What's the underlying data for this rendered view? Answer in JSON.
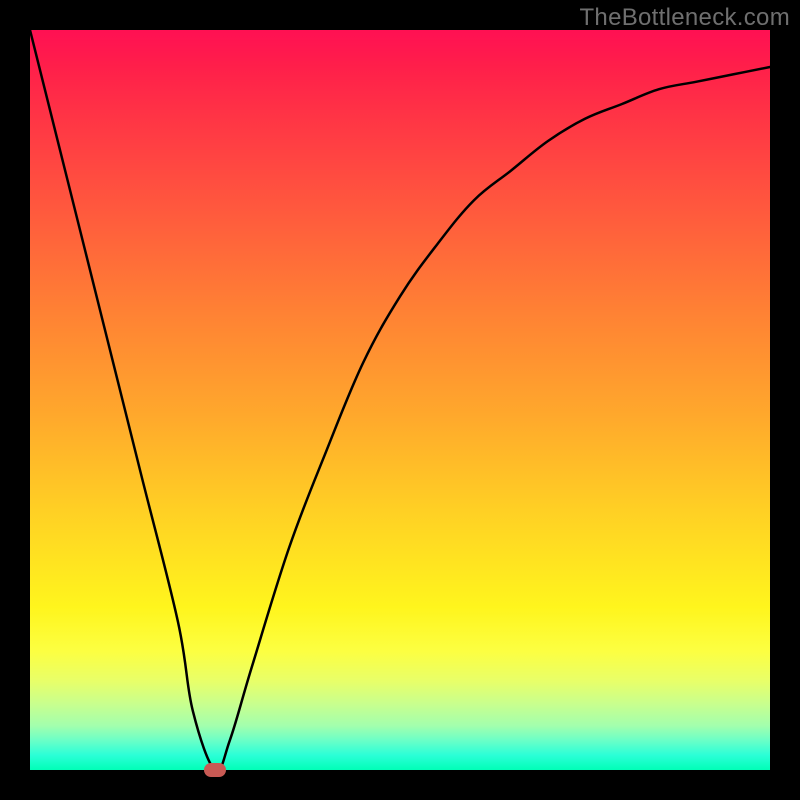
{
  "watermark": "TheBottleneck.com",
  "colors": {
    "frame": "#000000",
    "curve": "#000000",
    "marker": "#c85a54",
    "gradient_top": "#ff1053",
    "gradient_bottom": "#00ffb7"
  },
  "chart_data": {
    "type": "line",
    "title": "",
    "xlabel": "",
    "ylabel": "",
    "xlim": [
      0,
      100
    ],
    "ylim": [
      0,
      100
    ],
    "grid": false,
    "legend": false,
    "series": [
      {
        "name": "bottleneck-curve",
        "x": [
          0,
          5,
          10,
          15,
          20,
          22,
          25,
          27,
          30,
          35,
          40,
          45,
          50,
          55,
          60,
          65,
          70,
          75,
          80,
          85,
          90,
          95,
          100
        ],
        "values": [
          100,
          80,
          60,
          40,
          20,
          8,
          0,
          4,
          14,
          30,
          43,
          55,
          64,
          71,
          77,
          81,
          85,
          88,
          90,
          92,
          93,
          94,
          95
        ]
      }
    ],
    "annotations": [
      {
        "name": "minimum-marker",
        "x": 25,
        "y": 0
      }
    ]
  }
}
